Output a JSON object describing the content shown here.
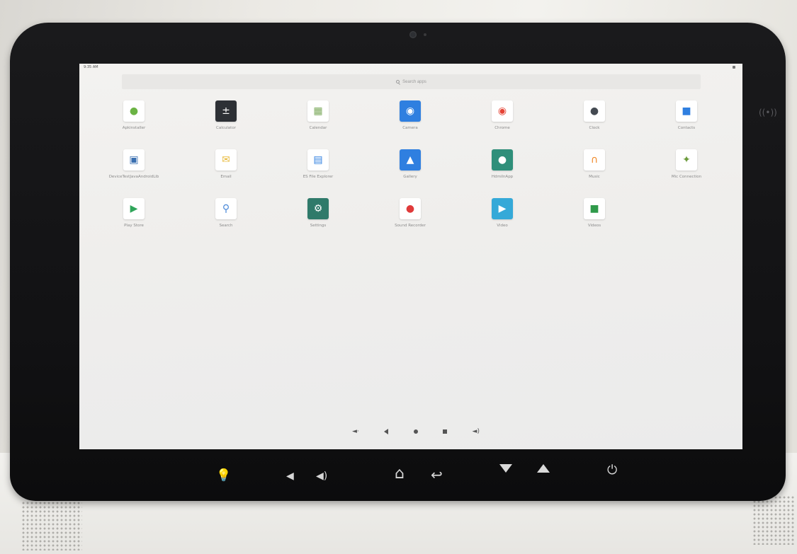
{
  "statusbar": {
    "time": "9:35 AM"
  },
  "search": {
    "placeholder": "Search apps"
  },
  "apps": [
    {
      "label": "Apkinstaller",
      "icon": "apkinstaller-icon",
      "color": "#ffffff",
      "glyph": "●",
      "glyph_color": "#6bb344"
    },
    {
      "label": "Calculator",
      "icon": "calculator-icon",
      "color": "#2d3035",
      "glyph": "±",
      "glyph_color": "#ffffff"
    },
    {
      "label": "Calendar",
      "icon": "calendar-icon",
      "color": "#ffffff",
      "glyph": "▦",
      "glyph_color": "#7aa85a"
    },
    {
      "label": "Camera",
      "icon": "camera-icon",
      "color": "#2f7fe0",
      "glyph": "◉",
      "glyph_color": "#ffffff"
    },
    {
      "label": "Chrome",
      "icon": "chrome-icon",
      "color": "#ffffff",
      "glyph": "◉",
      "glyph_color": "#e54335"
    },
    {
      "label": "Clock",
      "icon": "clock-icon",
      "color": "#ffffff",
      "glyph": "●",
      "glyph_color": "#444a52"
    },
    {
      "label": "Contacts",
      "icon": "contacts-icon",
      "color": "#ffffff",
      "glyph": "■",
      "glyph_color": "#2f7fe0"
    },
    {
      "label": "DeviceTestJavaAndroidLib",
      "icon": "devicetest-icon",
      "color": "#ffffff",
      "glyph": "▣",
      "glyph_color": "#3a6fb0"
    },
    {
      "label": "Email",
      "icon": "email-icon",
      "color": "#ffffff",
      "glyph": "✉",
      "glyph_color": "#e8b93a"
    },
    {
      "label": "ES File Explorer",
      "icon": "file-explorer-icon",
      "color": "#ffffff",
      "glyph": "▤",
      "glyph_color": "#2f7fe0"
    },
    {
      "label": "Gallery",
      "icon": "gallery-icon",
      "color": "#2f7fe0",
      "glyph": "▲",
      "glyph_color": "#ffffff"
    },
    {
      "label": "HdmiInApp",
      "icon": "android-app-icon",
      "color": "#2f8f7a",
      "glyph": "●",
      "glyph_color": "#ffffff"
    },
    {
      "label": "Music",
      "icon": "music-headphones-icon",
      "color": "#ffffff",
      "glyph": "∩",
      "glyph_color": "#f08a2a"
    },
    {
      "label": "Mic Connection",
      "icon": "mic-connection-icon",
      "color": "#ffffff",
      "glyph": "✦",
      "glyph_color": "#6b9a3a"
    },
    {
      "label": "Play Store",
      "icon": "play-store-icon",
      "color": "#ffffff",
      "glyph": "▶",
      "glyph_color": "#2fa55a"
    },
    {
      "label": "Search",
      "icon": "search-app-icon",
      "color": "#ffffff",
      "glyph": "⚲",
      "glyph_color": "#4a88d8"
    },
    {
      "label": "Settings",
      "icon": "settings-gear-icon",
      "color": "#2f7a6a",
      "glyph": "⚙",
      "glyph_color": "#ffffff"
    },
    {
      "label": "Sound Recorder",
      "icon": "sound-recorder-icon",
      "color": "#ffffff",
      "glyph": "●",
      "glyph_color": "#e03a3a"
    },
    {
      "label": "Video",
      "icon": "video-icon",
      "color": "#35a9d8",
      "glyph": "▶",
      "glyph_color": "#ffffff"
    },
    {
      "label": "Videos",
      "icon": "videos-icon",
      "color": "#ffffff",
      "glyph": "■",
      "glyph_color": "#2f9a4a"
    }
  ],
  "screen_nav": {
    "vol_down": "🔉",
    "back": "back",
    "home": "home",
    "recents": "recents",
    "vol_up": "🔊"
  },
  "hardware_keys": {
    "light": "❖",
    "vol_down": "◀",
    "vol_up": "◀)",
    "home": "⌂",
    "back": "↩",
    "power": "⏻"
  }
}
